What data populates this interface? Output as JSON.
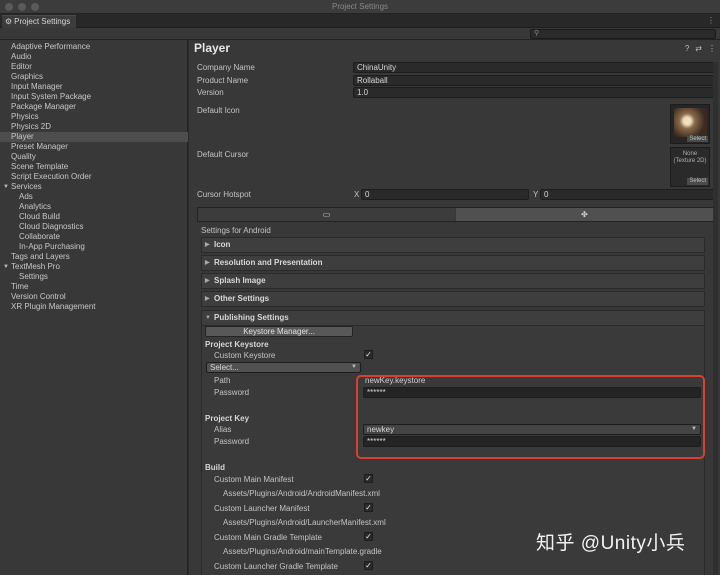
{
  "window": {
    "title": "Project Settings"
  },
  "tab": {
    "label": "Project Settings",
    "icon": "gear-icon"
  },
  "search": {
    "placeholder": ""
  },
  "sidebar": {
    "items": [
      {
        "label": "Adaptive Performance"
      },
      {
        "label": "Audio"
      },
      {
        "label": "Editor"
      },
      {
        "label": "Graphics"
      },
      {
        "label": "Input Manager"
      },
      {
        "label": "Input System Package"
      },
      {
        "label": "Package Manager"
      },
      {
        "label": "Physics"
      },
      {
        "label": "Physics 2D"
      },
      {
        "label": "Player",
        "selected": true
      },
      {
        "label": "Preset Manager"
      },
      {
        "label": "Quality"
      },
      {
        "label": "Scene Template"
      },
      {
        "label": "Script Execution Order"
      },
      {
        "label": "Services",
        "group": true
      },
      {
        "label": "Ads",
        "child": true
      },
      {
        "label": "Analytics",
        "child": true
      },
      {
        "label": "Cloud Build",
        "child": true
      },
      {
        "label": "Cloud Diagnostics",
        "child": true
      },
      {
        "label": "Collaborate",
        "child": true
      },
      {
        "label": "In-App Purchasing",
        "child": true
      },
      {
        "label": "Tags and Layers"
      },
      {
        "label": "TextMesh Pro",
        "group": true
      },
      {
        "label": "Settings",
        "child": true
      },
      {
        "label": "Time"
      },
      {
        "label": "Version Control"
      },
      {
        "label": "XR Plugin Management"
      }
    ]
  },
  "player": {
    "heading": "Player",
    "company_label": "Company Name",
    "company_value": "ChinaUnity",
    "product_label": "Product Name",
    "product_value": "Rollaball",
    "version_label": "Version",
    "version_value": "1.0",
    "default_icon_label": "Default Icon",
    "icon_select": "Select",
    "default_cursor_label": "Default Cursor",
    "cursor_none": "None",
    "cursor_type": "(Texture 2D)",
    "cursor_select": "Select",
    "hotspot_label": "Cursor Hotspot",
    "hotspot_x_label": "X",
    "hotspot_x": "0",
    "hotspot_y_label": "Y",
    "hotspot_y": "0",
    "settings_for": "Settings for Android"
  },
  "sections": {
    "icon": "Icon",
    "resolution": "Resolution and Presentation",
    "splash": "Splash Image",
    "other": "Other Settings",
    "publishing": "Publishing Settings"
  },
  "publishing": {
    "keystore_manager": "Keystore Manager...",
    "project_keystore": "Project Keystore",
    "custom_keystore": "Custom Keystore",
    "custom_keystore_checked": true,
    "select_dropdown": "Select...",
    "path_label": "Path",
    "path_value": "newKey.keystore",
    "password_label": "Password",
    "password_value": "******",
    "project_key": "Project Key",
    "alias_label": "Alias",
    "alias_value": "newkey",
    "key_password_label": "Password",
    "key_password_value": "******",
    "build": "Build",
    "main_manifest": "Custom Main Manifest",
    "main_manifest_path": "Assets/Plugins/Android/AndroidManifest.xml",
    "launcher_manifest": "Custom Launcher Manifest",
    "launcher_manifest_path": "Assets/Plugins/Android/LauncherManifest.xml",
    "main_gradle": "Custom Main Gradle Template",
    "main_gradle_path": "Assets/Plugins/Android/mainTemplate.gradle",
    "launcher_gradle": "Custom Launcher Gradle Template"
  },
  "watermark": "知乎 @Unity小兵",
  "colors": {
    "highlight_box": "#d8412f",
    "selected_item": "#4d4d4d"
  }
}
